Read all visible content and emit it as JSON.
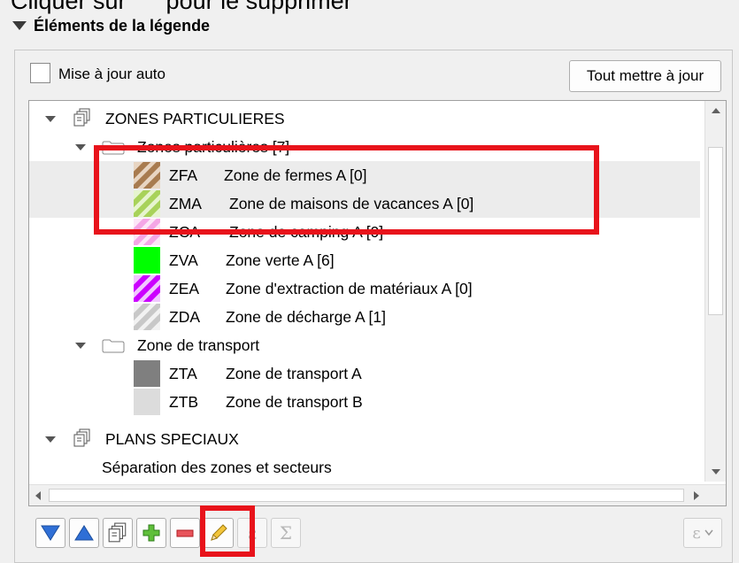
{
  "caption": "Cliquer sur      pour le supprimer",
  "section": {
    "title": "Éléments de la légende"
  },
  "auto_update": {
    "label": "Mise à jour auto",
    "checked": false
  },
  "update_all_button": "Tout mettre à jour",
  "tree": {
    "groups": [
      {
        "label": "ZONES PARTICULIERES"
      },
      {
        "label": "Zones particulières [7]"
      },
      {
        "label": "Zone de transport"
      },
      {
        "label": "PLANS SPECIAUX"
      }
    ],
    "items": [
      {
        "code": "ZFA",
        "name": "Zone de fermes A [0]",
        "color": "#a87b4f",
        "pattern": "hatch"
      },
      {
        "code": "ZMA",
        "name": "Zone de maisons de vacances A [0]",
        "color": "#a8d25a",
        "pattern": "hatch"
      },
      {
        "code": "ZCA",
        "name": "Zone de camping A [0]",
        "color": "#f4a6e6",
        "pattern": "hatch"
      },
      {
        "code": "ZVA",
        "name": "Zone verte A [6]",
        "color": "#00ff00",
        "pattern": "solid"
      },
      {
        "code": "ZEA",
        "name": "Zone d'extraction de matériaux A [0]",
        "color": "#cc00ff",
        "pattern": "hatch"
      },
      {
        "code": "ZDA",
        "name": "Zone de décharge A [1]",
        "color": "#c8c8c8",
        "pattern": "hatch"
      },
      {
        "code": "ZTA",
        "name": "Zone de transport A",
        "color": "#7f7f7f",
        "pattern": "solid"
      },
      {
        "code": "ZTB",
        "name": "Zone de transport B",
        "color": "#dcdcdc",
        "pattern": "solid"
      }
    ],
    "separator_label": "Séparation des zones et secteurs"
  },
  "toolbar": {
    "buttons": [
      {
        "name": "move-down-button",
        "icon": "triangle-down-icon"
      },
      {
        "name": "move-up-button",
        "icon": "triangle-up-icon"
      },
      {
        "name": "add-group-button",
        "icon": "group-layers-icon"
      },
      {
        "name": "add-item-button",
        "icon": "plus-icon"
      },
      {
        "name": "remove-item-button",
        "icon": "minus-icon"
      },
      {
        "name": "edit-item-button",
        "icon": "pencil-icon"
      },
      {
        "name": "expression-button",
        "icon": "epsilon-icon"
      },
      {
        "name": "sum-button",
        "icon": "sigma-icon"
      },
      {
        "name": "filter-expression-button",
        "icon": "epsilon-filter-icon"
      }
    ],
    "epsilon_glyph": "ε",
    "sigma_glyph": "Σ"
  },
  "highlight_color": "#e8131b"
}
